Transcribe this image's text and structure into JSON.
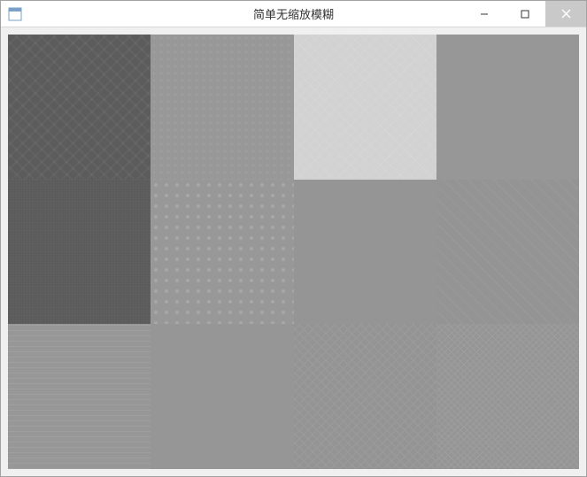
{
  "window": {
    "title": "简单无缩放模糊",
    "icons": {
      "app": "app-icon",
      "minimize": "minimize-icon",
      "maximize": "maximize-icon",
      "close": "close-icon"
    }
  }
}
